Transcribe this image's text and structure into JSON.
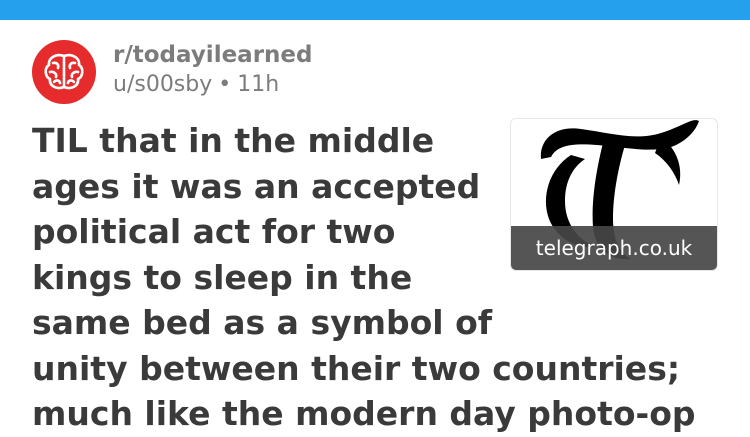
{
  "colors": {
    "top_bar": "#24a0ed",
    "avatar_bg": "#e52b2b",
    "meta_text": "#7c7c7c",
    "title_text": "#3a3a3a",
    "thumbnail_caption_bg": "#464646"
  },
  "post": {
    "subreddit": "r/todayilearned",
    "author": "u/s00sby",
    "separator": "•",
    "age": "11h",
    "avatar_icon": "brain-icon",
    "title_lines": [
      "TIL that in the middle",
      "ages it was an accepted",
      "political act for two",
      "kings to sleep in the",
      "same bed as a symbol of",
      "unity between their two countries;",
      "much like the modern day photo-op"
    ],
    "thumbnail": {
      "logo_icon": "telegraph-t-logo",
      "domain": "telegraph.co.uk"
    }
  }
}
